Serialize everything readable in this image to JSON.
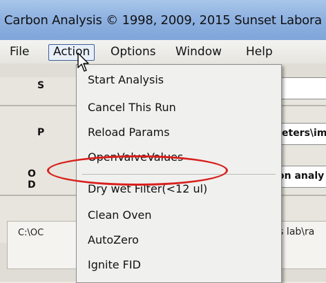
{
  "window": {
    "title": "Carbon Analysis © 1998, 2009, 2015 Sunset Labora"
  },
  "menubar": {
    "items": [
      "File",
      "Action",
      "Options",
      "Window",
      "Help"
    ],
    "active": "Action"
  },
  "background_fields": {
    "s_label": "S",
    "p_label": "P",
    "p_value": "eters\\im",
    "od_label_1": "O",
    "od_label_2": "D",
    "od_value": "on analy",
    "path_left": "C:\\OC",
    "path_right": "sis lab\\ra"
  },
  "action_menu": {
    "items": [
      "Start Analysis",
      "Cancel This Run",
      "Reload Params",
      "OpenValveValues",
      "Dry wet Filter(<12 ul)",
      "Clean Oven",
      "AutoZero",
      "Ignite FID"
    ],
    "circled_item": "Dry wet Filter(<12 ul)"
  },
  "colors": {
    "circle_annotation": "#d8201c",
    "titlebar": "#8fb2e1"
  },
  "icons": {
    "cursor": "mouse-pointer-icon"
  }
}
